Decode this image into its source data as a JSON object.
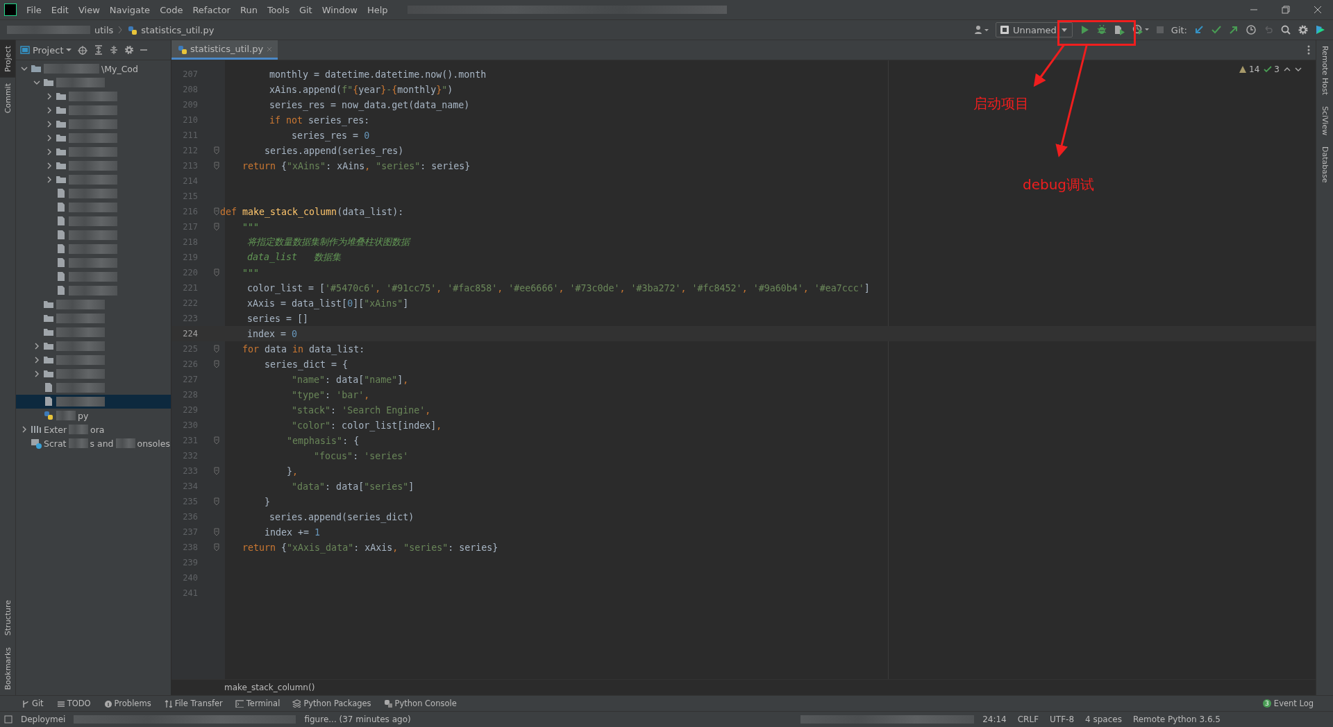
{
  "menu": [
    "File",
    "Edit",
    "View",
    "Navigate",
    "Code",
    "Refactor",
    "Run",
    "Tools",
    "Git",
    "Window",
    "Help"
  ],
  "breadcrumb": {
    "folder": "utils",
    "file": "statistics_util.py"
  },
  "toolbar": {
    "run_config": "Unnamed",
    "git_label": "Git:"
  },
  "left_strip": {
    "top": [
      {
        "label": "Project",
        "selected": true
      },
      {
        "label": "Commit",
        "selected": false
      }
    ],
    "bottom": [
      {
        "label": "Structure",
        "selected": false
      },
      {
        "label": "Bookmarks",
        "selected": false
      }
    ]
  },
  "right_strip": [
    "Remote Host",
    "SciView",
    "Database"
  ],
  "project": {
    "title": "Project",
    "tree": [
      {
        "kind": "module",
        "expanded": true,
        "selected": false,
        "label": [
          "\\My_Cod"
        ],
        "children": [
          {
            "kind": "folder",
            "expanded": true,
            "selected": false,
            "children": [
              {
                "kind": "folder",
                "expanded": false,
                "selected": false
              },
              {
                "kind": "folder",
                "expanded": false,
                "selected": false
              },
              {
                "kind": "folder",
                "expanded": false,
                "selected": false
              },
              {
                "kind": "folder",
                "expanded": false,
                "selected": false
              },
              {
                "kind": "folder",
                "expanded": false,
                "selected": false
              },
              {
                "kind": "folder",
                "expanded": false,
                "selected": false
              },
              {
                "kind": "folder",
                "expanded": false,
                "selected": false
              },
              {
                "kind": "file",
                "selected": false
              },
              {
                "kind": "file",
                "selected": false
              },
              {
                "kind": "file",
                "selected": false
              },
              {
                "kind": "file",
                "selected": false
              },
              {
                "kind": "file",
                "selected": false
              },
              {
                "kind": "file",
                "selected": false
              },
              {
                "kind": "file",
                "selected": false
              },
              {
                "kind": "file",
                "selected": false
              }
            ]
          },
          {
            "kind": "folder",
            "selected": false
          },
          {
            "kind": "folder",
            "selected": false
          },
          {
            "kind": "folder",
            "selected": false
          },
          {
            "kind": "folder",
            "expanded": false,
            "selected": false
          },
          {
            "kind": "folder",
            "expanded": false,
            "selected": false
          },
          {
            "kind": "folder",
            "expanded": false,
            "selected": false
          },
          {
            "kind": "file",
            "selected": false
          },
          {
            "kind": "file",
            "selected": true
          },
          {
            "kind": "pyfile",
            "selected": false,
            "label": [
              "py"
            ]
          }
        ]
      },
      {
        "kind": "library",
        "expanded": false,
        "selected": false,
        "label": [
          "Exter",
          "ora"
        ]
      },
      {
        "kind": "scratch",
        "selected": false,
        "label": [
          "Scrat",
          "s and ",
          "onsoles"
        ]
      }
    ]
  },
  "editor": {
    "tab": {
      "label": "statistics_util.py",
      "selected": true
    },
    "warnings": "14",
    "checks": "3",
    "breadcrumb": "make_stack_column()",
    "lines": [
      {
        "n": "207",
        "code": [
          {
            "kind": "plain",
            "text": "        monthly = datetime.datetime.now().month"
          }
        ]
      },
      {
        "n": "208",
        "code": [
          {
            "kind": "plain",
            "text": "        xAins.append("
          },
          {
            "kind": "string",
            "text": "f\""
          },
          {
            "kind": "keyword",
            "text": "{"
          },
          {
            "kind": "plain",
            "text": "year"
          },
          {
            "kind": "keyword",
            "text": "}"
          },
          {
            "kind": "string",
            "text": "-"
          },
          {
            "kind": "keyword",
            "text": "{"
          },
          {
            "kind": "plain",
            "text": "monthly"
          },
          {
            "kind": "keyword",
            "text": "}"
          },
          {
            "kind": "string",
            "text": "\""
          },
          {
            "kind": "plain",
            "text": ")"
          }
        ]
      },
      {
        "n": "209",
        "code": [
          {
            "kind": "plain",
            "text": "        series_res = now_data.get(data_name)"
          }
        ]
      },
      {
        "n": "210",
        "code": [
          {
            "kind": "keyword",
            "text": "        if not"
          },
          {
            "kind": "plain",
            "text": " series_res:"
          }
        ]
      },
      {
        "n": "211",
        "code": [
          {
            "kind": "plain",
            "text": "            series_res = "
          },
          {
            "kind": "number",
            "text": "0"
          }
        ]
      },
      {
        "n": "212",
        "fold": true,
        "code": [
          {
            "kind": "plain",
            "text": "        series.append(series_res)"
          }
        ]
      },
      {
        "n": "213",
        "fold": true,
        "code": [
          {
            "kind": "keyword",
            "text": "    return"
          },
          {
            "kind": "plain",
            "text": " {"
          },
          {
            "kind": "string",
            "text": "\"xAins\""
          },
          {
            "kind": "plain",
            "text": ": xAins"
          },
          {
            "kind": "keyword",
            "text": ","
          },
          {
            "kind": "string",
            "text": " \"series\""
          },
          {
            "kind": "plain",
            "text": ": series}"
          }
        ]
      },
      {
        "n": "214"
      },
      {
        "n": "215"
      },
      {
        "n": "216",
        "fold": true,
        "code": [
          {
            "kind": "keyword",
            "text": "def "
          },
          {
            "kind": "function",
            "text": "make_stack_column"
          },
          {
            "kind": "plain",
            "text": "(data_list):"
          }
        ]
      },
      {
        "n": "217",
        "fold": true,
        "code": [
          {
            "kind": "docstring",
            "text": "    \"\"\""
          }
        ]
      },
      {
        "n": "218",
        "code": [
          {
            "kind": "docstring",
            "text": "    将指定数量数据集制作为堆叠柱状图数据"
          }
        ]
      },
      {
        "n": "219",
        "code": [
          {
            "kind": "docstring",
            "text": "    data_list   数据集"
          }
        ]
      },
      {
        "n": "220",
        "fold": true,
        "code": [
          {
            "kind": "docstring",
            "text": "    \"\"\""
          }
        ]
      },
      {
        "n": "221",
        "code": [
          {
            "kind": "plain",
            "text": "    color_list = ["
          },
          {
            "kind": "string",
            "text": "'#5470c6'"
          },
          {
            "kind": "keyword",
            "text": ", "
          },
          {
            "kind": "string",
            "text": "'#91cc75'"
          },
          {
            "kind": "keyword",
            "text": ", "
          },
          {
            "kind": "string",
            "text": "'#fac858'"
          },
          {
            "kind": "keyword",
            "text": ", "
          },
          {
            "kind": "string",
            "text": "'#ee6666'"
          },
          {
            "kind": "keyword",
            "text": ", "
          },
          {
            "kind": "string",
            "text": "'#73c0de'"
          },
          {
            "kind": "keyword",
            "text": ", "
          },
          {
            "kind": "string",
            "text": "'#3ba272'"
          },
          {
            "kind": "keyword",
            "text": ", "
          },
          {
            "kind": "string",
            "text": "'#fc8452'"
          },
          {
            "kind": "keyword",
            "text": ", "
          },
          {
            "kind": "string",
            "text": "'#9a60b4'"
          },
          {
            "kind": "keyword",
            "text": ", "
          },
          {
            "kind": "string",
            "text": "'#ea7ccc'"
          },
          {
            "kind": "plain",
            "text": "]"
          }
        ]
      },
      {
        "n": "222",
        "code": [
          {
            "kind": "plain",
            "text": "    xAxis = data_list["
          },
          {
            "kind": "number",
            "text": "0"
          },
          {
            "kind": "plain",
            "text": "]["
          },
          {
            "kind": "string",
            "text": "\"xAins\""
          },
          {
            "kind": "plain",
            "text": "]"
          }
        ]
      },
      {
        "n": "223",
        "code": [
          {
            "kind": "plain",
            "text": "    series = []"
          }
        ]
      },
      {
        "n": "224",
        "current": true,
        "code": [
          {
            "kind": "plain",
            "text": "    index = "
          },
          {
            "kind": "number",
            "text": "0"
          }
        ]
      },
      {
        "n": "225",
        "fold": true,
        "code": [
          {
            "kind": "keyword",
            "text": "    for"
          },
          {
            "kind": "plain",
            "text": " data "
          },
          {
            "kind": "keyword",
            "text": "in"
          },
          {
            "kind": "plain",
            "text": " data_list:"
          }
        ]
      },
      {
        "n": "226",
        "fold": true,
        "code": [
          {
            "kind": "plain",
            "text": "        series_dict = {"
          }
        ]
      },
      {
        "n": "227",
        "code": [
          {
            "kind": "string",
            "text": "            \"name\""
          },
          {
            "kind": "plain",
            "text": ": data["
          },
          {
            "kind": "string",
            "text": "\"name\""
          },
          {
            "kind": "plain",
            "text": "]"
          },
          {
            "kind": "keyword",
            "text": ","
          }
        ]
      },
      {
        "n": "228",
        "code": [
          {
            "kind": "string",
            "text": "            \"type\""
          },
          {
            "kind": "plain",
            "text": ": "
          },
          {
            "kind": "string",
            "text": "'bar'"
          },
          {
            "kind": "keyword",
            "text": ","
          }
        ]
      },
      {
        "n": "229",
        "code": [
          {
            "kind": "string",
            "text": "            \"stack\""
          },
          {
            "kind": "plain",
            "text": ": "
          },
          {
            "kind": "string",
            "text": "'Search Engine'"
          },
          {
            "kind": "keyword",
            "text": ","
          }
        ]
      },
      {
        "n": "230",
        "code": [
          {
            "kind": "string",
            "text": "            \"color\""
          },
          {
            "kind": "plain",
            "text": ": color_list[index]"
          },
          {
            "kind": "keyword",
            "text": ","
          }
        ]
      },
      {
        "n": "231",
        "fold": true,
        "code": [
          {
            "kind": "string",
            "text": "            \"emphasis\""
          },
          {
            "kind": "plain",
            "text": ": {"
          }
        ]
      },
      {
        "n": "232",
        "code": [
          {
            "kind": "string",
            "text": "                \"focus\""
          },
          {
            "kind": "plain",
            "text": ": "
          },
          {
            "kind": "string",
            "text": "'series'"
          }
        ]
      },
      {
        "n": "233",
        "fold": true,
        "code": [
          {
            "kind": "plain",
            "text": "            }"
          },
          {
            "kind": "keyword",
            "text": ","
          }
        ]
      },
      {
        "n": "234",
        "code": [
          {
            "kind": "string",
            "text": "            \"data\""
          },
          {
            "kind": "plain",
            "text": ": data["
          },
          {
            "kind": "string",
            "text": "\"series\""
          },
          {
            "kind": "plain",
            "text": "]"
          }
        ]
      },
      {
        "n": "235",
        "fold": true,
        "code": [
          {
            "kind": "plain",
            "text": "        }"
          }
        ]
      },
      {
        "n": "236",
        "code": [
          {
            "kind": "plain",
            "text": "        series.append(series_dict)"
          }
        ]
      },
      {
        "n": "237",
        "fold": true,
        "code": [
          {
            "kind": "plain",
            "text": "        index += "
          },
          {
            "kind": "number",
            "text": "1"
          }
        ]
      },
      {
        "n": "238",
        "fold": true,
        "code": [
          {
            "kind": "keyword",
            "text": "    return"
          },
          {
            "kind": "plain",
            "text": " {"
          },
          {
            "kind": "string",
            "text": "\"xAxis_data\""
          },
          {
            "kind": "plain",
            "text": ": xAxis"
          },
          {
            "kind": "keyword",
            "text": ","
          },
          {
            "kind": "string",
            "text": " \"series\""
          },
          {
            "kind": "plain",
            "text": ": series}"
          }
        ]
      },
      {
        "n": "239"
      },
      {
        "n": "240"
      },
      {
        "n": "241"
      }
    ]
  },
  "tool_windows": [
    {
      "label": "Git",
      "kind": "branch"
    },
    {
      "label": "TODO",
      "kind": "list"
    },
    {
      "label": "Problems",
      "kind": "info"
    },
    {
      "label": "File Transfer",
      "kind": "transfer"
    },
    {
      "label": "Terminal",
      "kind": "terminal"
    },
    {
      "label": "Python Packages",
      "kind": "layers"
    },
    {
      "label": "Python Console",
      "kind": "python"
    }
  ],
  "event_log": {
    "label": "Event Log",
    "count": "3"
  },
  "status": {
    "left": "Deploymei",
    "message": "figure... (37 minutes ago)",
    "items": [
      "24:14",
      "CRLF",
      "UTF-8",
      "4 spaces",
      "Remote Python 3.6.5"
    ]
  },
  "annotations": [
    {
      "label": "启动项目"
    },
    {
      "label": "debug调试"
    }
  ]
}
